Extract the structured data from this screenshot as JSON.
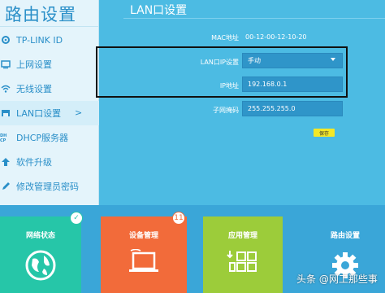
{
  "app": {
    "brand_title": "路由设置"
  },
  "sidebar": {
    "items": [
      {
        "label": "TP-LINK ID",
        "icon": "gear-icon"
      },
      {
        "label": "上网设置",
        "icon": "monitor-icon"
      },
      {
        "label": "无线设置",
        "icon": "wifi-icon"
      },
      {
        "label": "LAN口设置",
        "icon": "lan-port-icon",
        "chevron": ">"
      },
      {
        "label": "DHCP服务器",
        "icon": "dhcp-icon"
      },
      {
        "label": "软件升级",
        "icon": "upgrade-icon"
      },
      {
        "label": "修改管理员密码",
        "icon": "pencil-icon"
      }
    ]
  },
  "panel": {
    "title": "LAN口设置",
    "mac_label": "MAC地址",
    "mac_value": "00-12-00-12-10-20",
    "ip_mode_label": "LAN口IP设置",
    "ip_mode_value": "手动",
    "ip_label": "IP地址",
    "ip_value": "192.168.0.1",
    "mask_label": "子网掩码",
    "mask_value": "255.255.255.0",
    "save_label": "保存"
  },
  "tiles": [
    {
      "label": "网络状态",
      "color": "#26c6a8",
      "icon": "globe-icon",
      "badge": "✓"
    },
    {
      "label": "设备管理",
      "color": "#f26b3a",
      "icon": "laptop-icon",
      "badge": "11"
    },
    {
      "label": "应用管理",
      "color": "#9ccc3a",
      "icon": "apps-grid-icon"
    },
    {
      "label": "路由设置",
      "color": "#3aa6d8",
      "icon": "gear-icon"
    }
  ],
  "watermark": "头条 @网工那些事"
}
